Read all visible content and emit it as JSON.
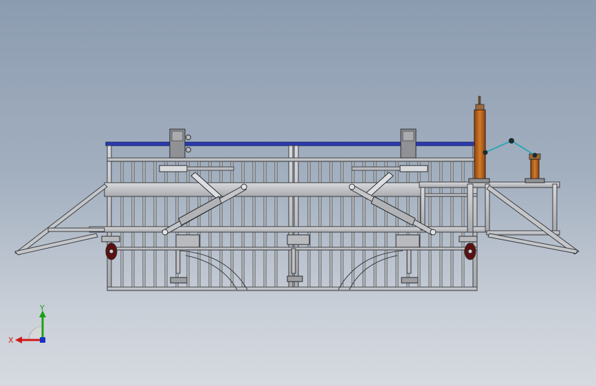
{
  "viewport": {
    "name": "graphics-area",
    "background_top": "#8c9cb0",
    "background_bottom": "#d6dae0"
  },
  "model": {
    "name": "frame-assembly",
    "frame_color": "#c4c6ca",
    "frame_stroke": "#3a3c40",
    "rail_color": "#2b3bb0",
    "cylinder_color": "#c0651a",
    "link_color": "#2aa7b8",
    "wheel_color": "#8a1a1a"
  },
  "triad": {
    "x_label": "X",
    "y_label": "Y",
    "x_color": "#d01818",
    "y_color": "#18a018",
    "z_color": "#1830c8"
  }
}
